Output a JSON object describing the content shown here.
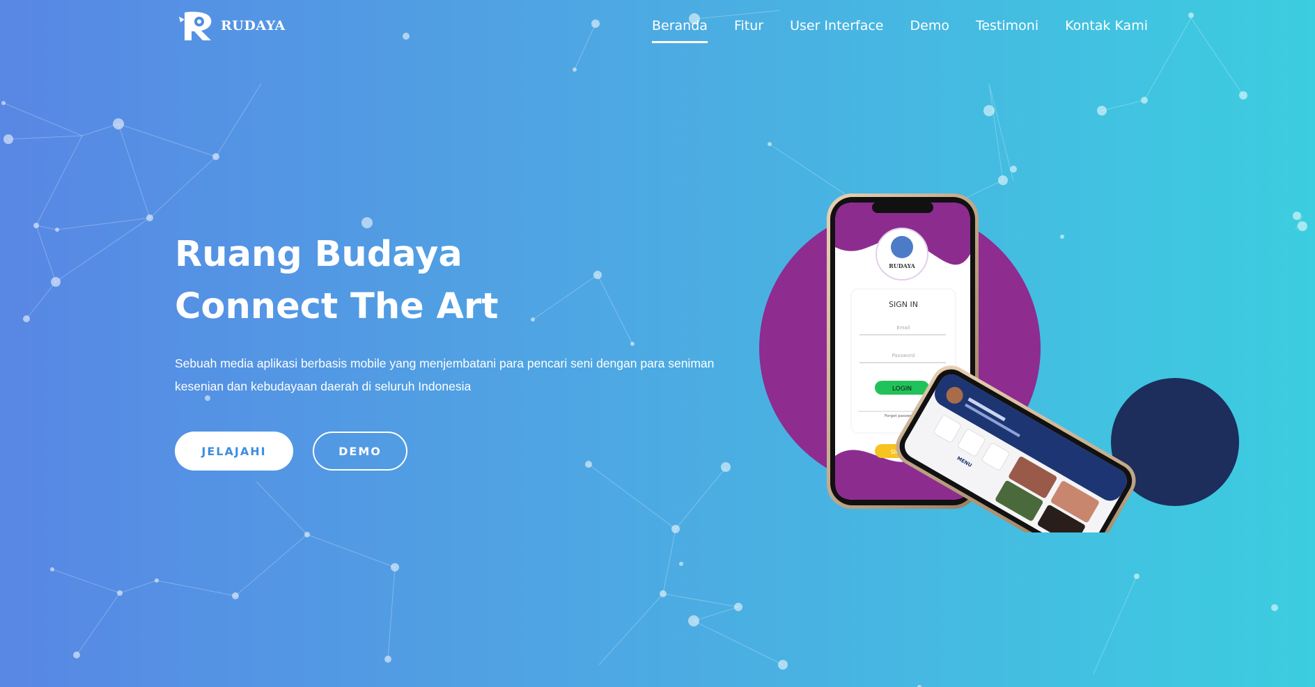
{
  "brand": {
    "name": "RUDAYA",
    "logo_icon": "rudaya-logo-icon"
  },
  "nav": {
    "items": [
      {
        "label": "Beranda",
        "active": true
      },
      {
        "label": "Fitur",
        "active": false
      },
      {
        "label": "User Interface",
        "active": false
      },
      {
        "label": "Demo",
        "active": false
      },
      {
        "label": "Testimoni",
        "active": false
      },
      {
        "label": "Kontak Kami",
        "active": false
      }
    ]
  },
  "hero": {
    "title_line1": "Ruang Budaya",
    "title_line2": "Connect The Art",
    "description": "Sebuah media aplikasi berbasis mobile yang menjembatani para pencari seni dengan para seniman kesenian dan kebudayaan daerah di seluruh Indonesia",
    "primary_button": "JELAJAHI",
    "secondary_button": "DEMO"
  },
  "phone_front": {
    "app_name": "RUDAYA",
    "screen_title": "SIGN IN",
    "email_placeholder": "Email",
    "password_placeholder": "Password",
    "login_button": "LOGIN",
    "forgot_link": "Forgot password ?",
    "signup_button": "SIGN UP"
  },
  "phone_back": {
    "menu_label": "MENU"
  },
  "colors": {
    "gradient_start": "#5887e4",
    "gradient_end": "#3ccde0",
    "purple_circle": "#8e2c90",
    "navy_circle": "#1d2d5c",
    "login_green": "#22c25a",
    "signup_yellow": "#f6c320"
  }
}
